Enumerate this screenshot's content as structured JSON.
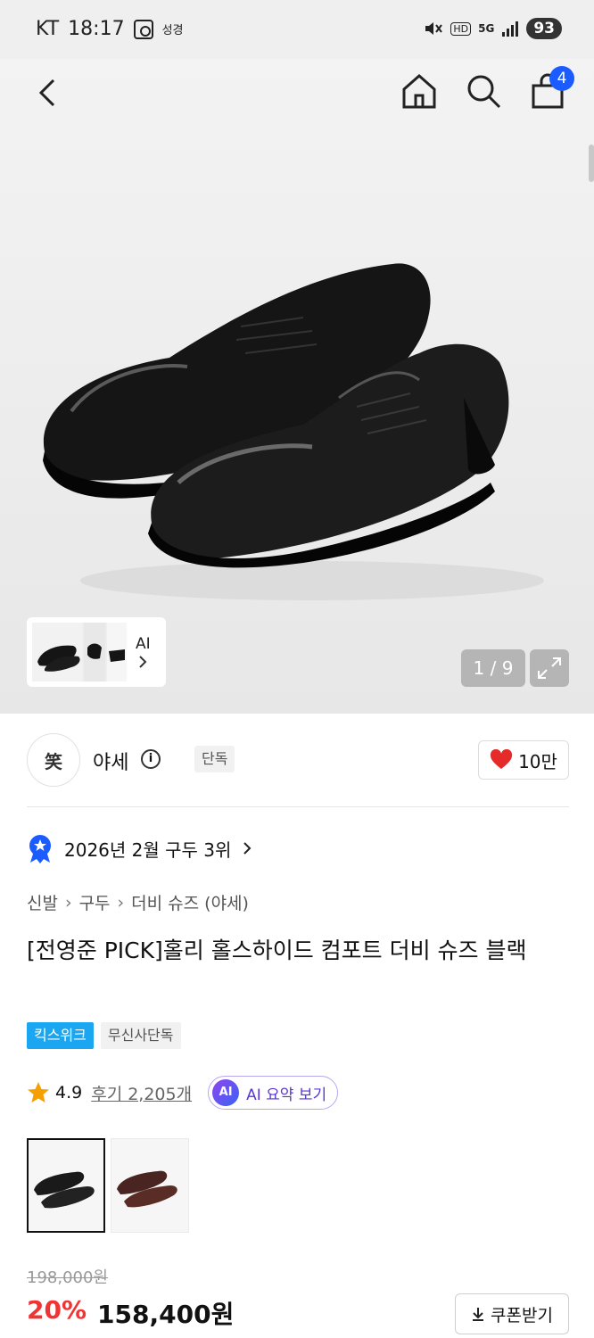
{
  "status_bar": {
    "carrier": "KT",
    "time": "18:17",
    "extra": "성경",
    "network": "5G",
    "hd": "HD",
    "battery": "93"
  },
  "nav": {
    "cart_count": "4"
  },
  "gallery": {
    "ai_label": "AI",
    "counter": "1 / 9"
  },
  "brand": {
    "logo_text": "笑",
    "name": "야세",
    "badge": "단독",
    "likes": "10만"
  },
  "ranking": {
    "text": "2026년 2월 구두 3위"
  },
  "breadcrumb": [
    "신발",
    "구두",
    "더비 슈즈 (야세)"
  ],
  "product": {
    "title": "[전영준 PICK]홀리 홀스하이드 컴포트 더비 슈즈 블랙",
    "tags": [
      "킥스위크",
      "무신사단독"
    ],
    "rating": "4.9",
    "reviews": "후기 2,205개",
    "ai_summary": "AI 요약 보기",
    "ai_dot": "AI"
  },
  "price": {
    "original": "198,000원",
    "discount": "20%",
    "current": "158,400원",
    "coupon_label": "쿠폰받기"
  },
  "colors": {
    "accent_blue": "#1a5cff",
    "sale_red": "#f03434",
    "tag_blue": "#1aa6f0"
  }
}
